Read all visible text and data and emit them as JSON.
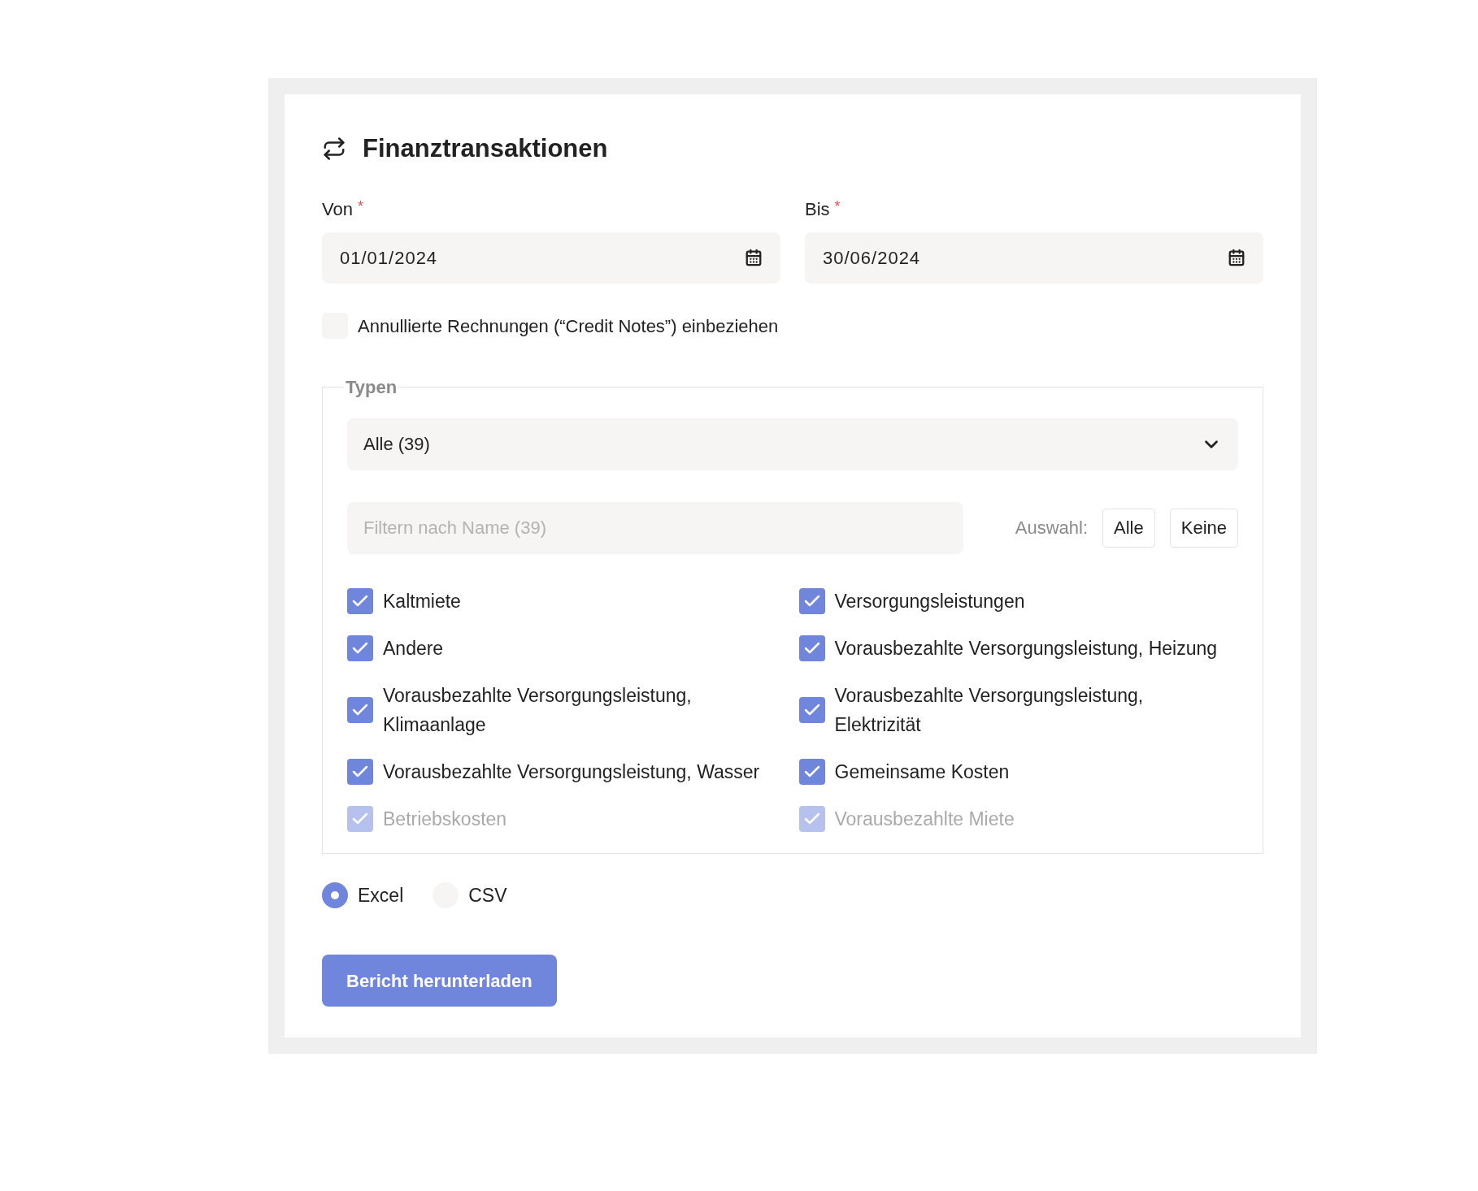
{
  "title": "Finanztransaktionen",
  "date_fields": [
    {
      "label": "Von",
      "required_mark": "*",
      "value": "01/01/2024"
    },
    {
      "label": "Bis",
      "required_mark": "*",
      "value": "30/06/2024"
    }
  ],
  "credit_notes": {
    "label": "Annullierte Rechnungen (“Credit Notes”) einbeziehen",
    "checked": false
  },
  "types": {
    "legend": "Typen",
    "select_value": "Alle (39)",
    "filter_placeholder": "Filtern nach Name (39)",
    "selection_label": "Auswahl:",
    "selection_buttons": [
      "Alle",
      "Keine"
    ],
    "items": [
      {
        "label": "Kaltmiete",
        "checked": true,
        "faded": false
      },
      {
        "label": "Versorgungsleistungen",
        "checked": true,
        "faded": false
      },
      {
        "label": "Andere",
        "checked": true,
        "faded": false
      },
      {
        "label": "Vorausbezahlte Versorgungsleistung, Heizung",
        "checked": true,
        "faded": false
      },
      {
        "label": "Vorausbezahlte Versorgungsleistung, Klimaanlage",
        "checked": true,
        "faded": false
      },
      {
        "label": "Vorausbezahlte Versorgungsleistung, Elektrizität",
        "checked": true,
        "faded": false
      },
      {
        "label": "Vorausbezahlte Versorgungsleistung, Wasser",
        "checked": true,
        "faded": false
      },
      {
        "label": "Gemeinsame Kosten",
        "checked": true,
        "faded": false
      },
      {
        "label": "Betriebskosten",
        "checked": true,
        "faded": true
      },
      {
        "label": "Vorausbezahlte Miete",
        "checked": true,
        "faded": true
      }
    ]
  },
  "formats": [
    {
      "label": "Excel",
      "selected": true
    },
    {
      "label": "CSV",
      "selected": false
    }
  ],
  "download_button": "Bericht herunterladen"
}
